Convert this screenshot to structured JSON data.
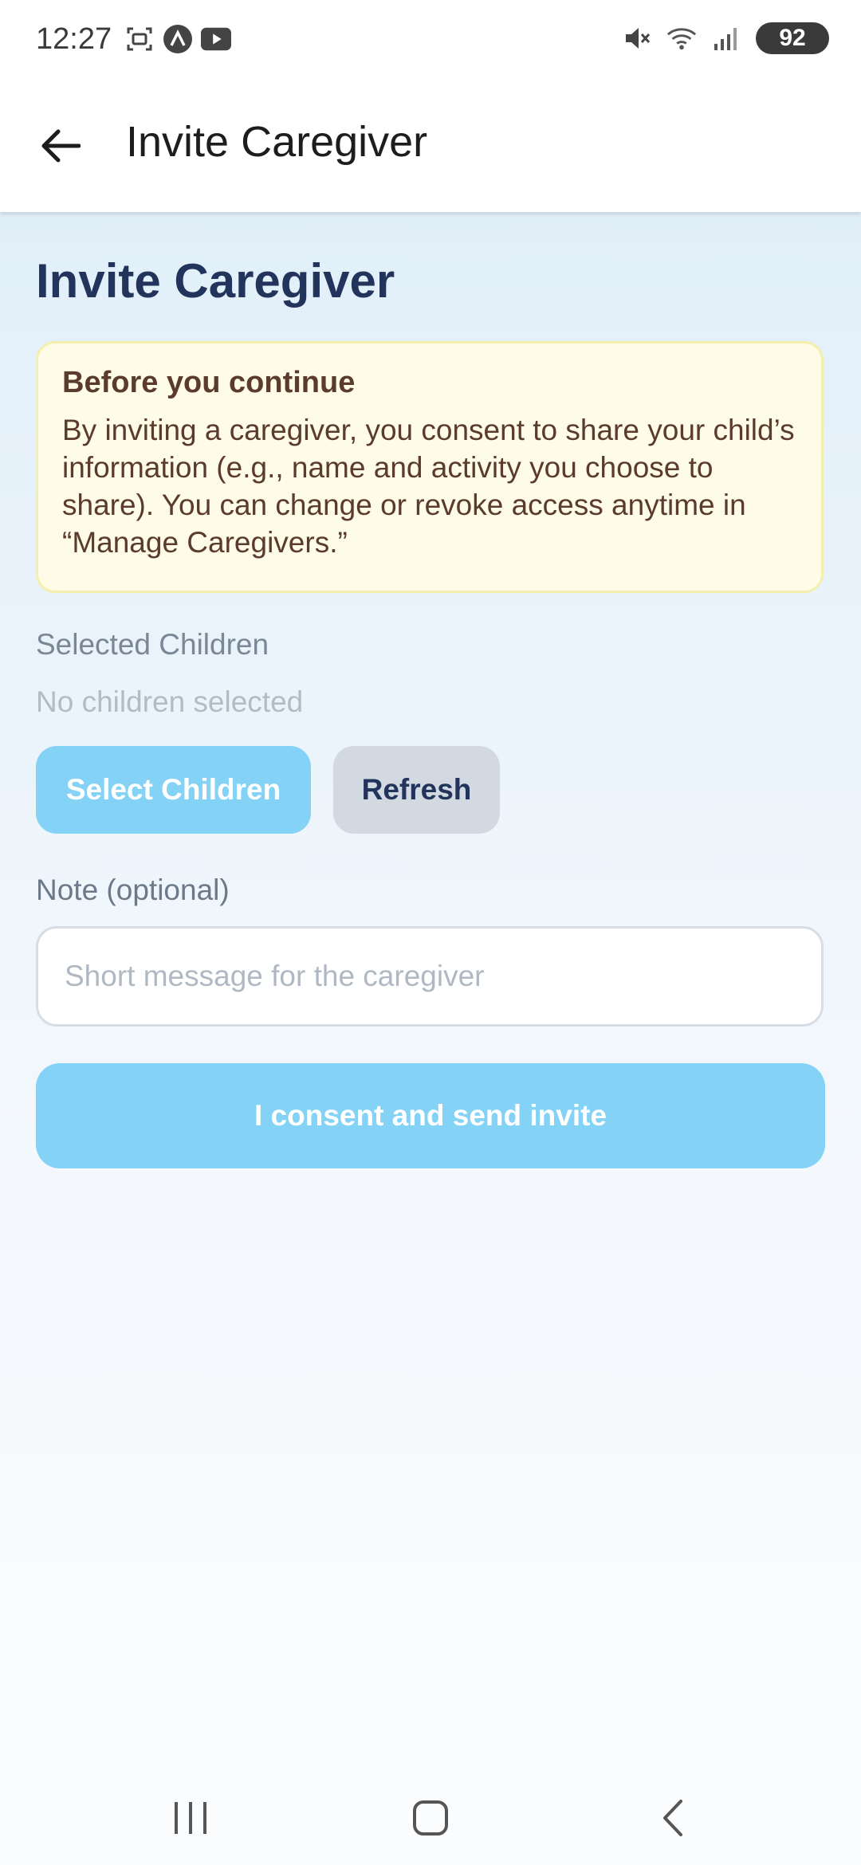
{
  "status_bar": {
    "time": "12:27",
    "battery": "92",
    "icons_left": [
      "screenshot-icon",
      "app-notification-icon",
      "youtube-icon"
    ],
    "icons_right": [
      "mute-icon",
      "wifi-icon",
      "signal-icon",
      "battery-icon"
    ]
  },
  "app_bar": {
    "title": "Invite Caregiver"
  },
  "main": {
    "heading": "Invite Caregiver",
    "notice": {
      "title": "Before you continue",
      "body": "By inviting a caregiver, you consent to share your child’s information (e.g., name and activity you choose to share). You can change or revoke access anytime in “Manage Caregivers.”"
    },
    "selected_children": {
      "label": "Selected Children",
      "empty_text": "No children selected",
      "select_button": "Select Children",
      "refresh_button": "Refresh"
    },
    "note": {
      "label": "Note (optional)",
      "placeholder": "Short message for the caregiver",
      "value": ""
    },
    "submit_button": "I consent and send invite"
  },
  "colors": {
    "primary_button": "#84d3f6",
    "heading": "#22345c",
    "notice_bg": "#fefce6",
    "notice_text": "#5b3b2e"
  }
}
